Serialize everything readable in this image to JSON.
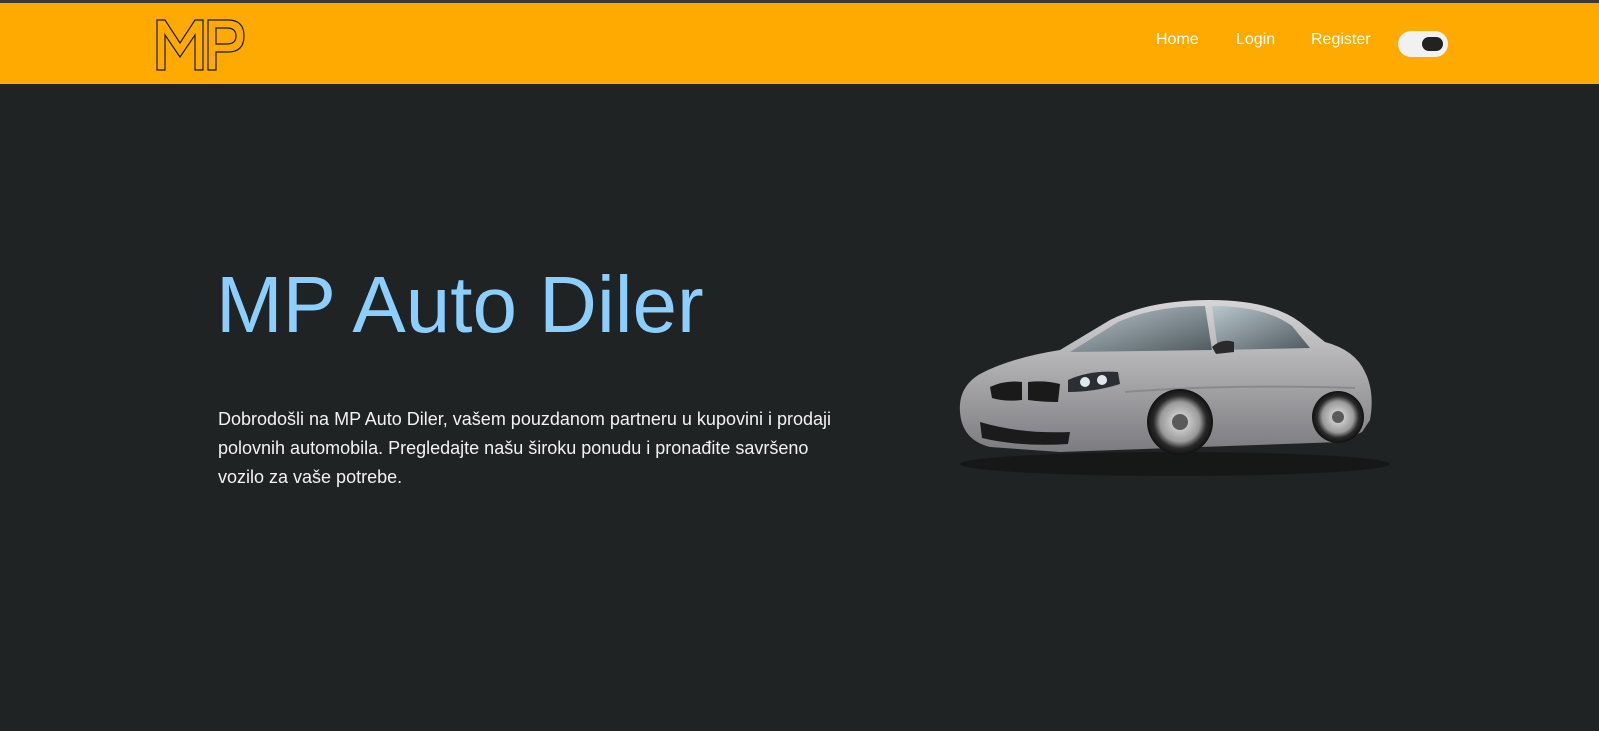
{
  "brand": {
    "logo_text": "MP"
  },
  "nav": {
    "home": "Home",
    "login": "Login",
    "register": "Register"
  },
  "theme_toggle": {
    "state": "dark"
  },
  "hero": {
    "title": "MP Auto Diler",
    "text": "Dobrodošli na MP Auto Diler, vašem pouzdanom partneru u kupovini i prodaji polovnih automobila. Pregledajte našu široku ponudu i pronađite savršeno vozilo za vaše potrebe."
  },
  "colors": {
    "navbar": "#ffaa00",
    "background": "#202324",
    "title": "#8ccfff",
    "text": "#f2f2f2"
  },
  "icons": {
    "logo": "mp-outline-logo",
    "car": "silver-sedan-image"
  }
}
